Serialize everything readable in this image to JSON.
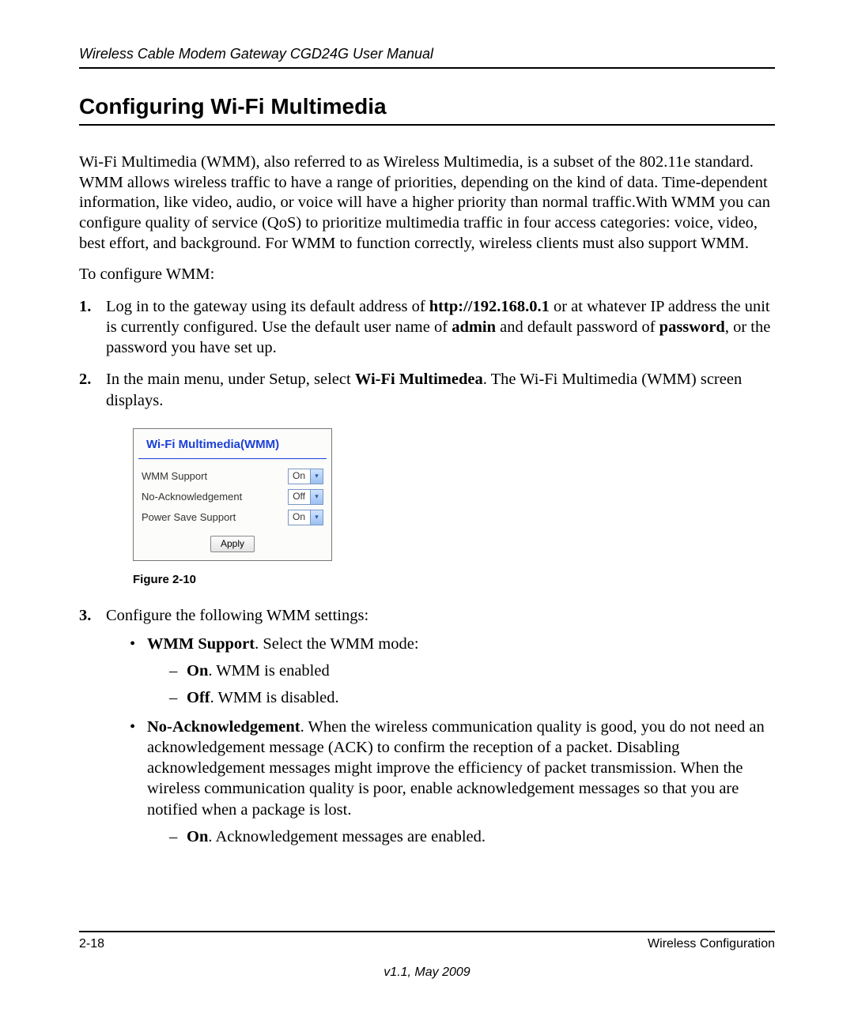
{
  "header": {
    "running": "Wireless Cable Modem Gateway CGD24G User Manual"
  },
  "title": "Configuring Wi-Fi Multimedia",
  "intro": "Wi-Fi Multimedia (WMM), also referred to as Wireless Multimedia, is a subset of the 802.11e standard. WMM allows wireless traffic to have a range of priorities, depending on the kind of data. Time-dependent information, like video, audio, or voice will have a higher priority than normal traffic.With WMM you can configure quality of service (QoS) to prioritize multimedia traffic in four access categories: voice, video, best effort, and background. For WMM to function correctly, wireless clients must also support WMM.",
  "lead": "To configure WMM:",
  "steps": {
    "s1_num": "1.",
    "s1_a": "Log in to the gateway using its default address of ",
    "s1_url": "http://192.168.0.1",
    "s1_b": " or at whatever IP address the unit is currently configured. Use the default user name of ",
    "s1_admin": "admin",
    "s1_c": " and default password of ",
    "s1_password": "password",
    "s1_d": ", or the password you have set up.",
    "s2_num": "2.",
    "s2_a": "In the main menu, under Setup, select ",
    "s2_menu": "Wi-Fi Multimedea",
    "s2_b": ". The Wi-Fi Multimedia (WMM) screen displays.",
    "s3_num": "3.",
    "s3_text": "Configure the following WMM settings:"
  },
  "panel": {
    "title": "Wi-Fi Multimedia(WMM)",
    "rows": {
      "support_label": "WMM Support",
      "support_val": "On",
      "noack_label": "No-Acknowledgement",
      "noack_val": "Off",
      "powersave_label": "Power Save Support",
      "powersave_val": "On"
    },
    "apply": "Apply"
  },
  "figure_caption": "Figure 2-10",
  "settings": {
    "wmm_label": "WMM Support",
    "wmm_text": ". Select the WMM mode:",
    "wmm_on_label": "On",
    "wmm_on_text": ". WMM is enabled",
    "wmm_off_label": "Off",
    "wmm_off_text": ". WMM is disabled.",
    "noack_label": "No-Acknowledgement",
    "noack_text": ". When the wireless communication quality is good, you do not need an acknowledgement message (ACK) to confirm the reception of a packet. Disabling acknowledgement messages might improve the efficiency of packet transmission. When the wireless communication quality is poor, enable acknowledgement messages so that you are notified when a package is lost.",
    "noack_on_label": "On",
    "noack_on_text": ". Acknowledgement messages are enabled."
  },
  "footer": {
    "page": "2-18",
    "section": "Wireless Configuration",
    "version": "v1.1, May 2009"
  }
}
